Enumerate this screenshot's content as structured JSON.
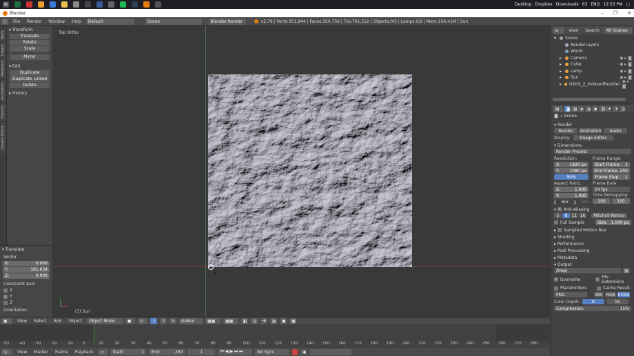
{
  "taskbar": {
    "items": [
      "Desktop",
      "Dropbox",
      "Downloads"
    ],
    "battery": "63",
    "lang": "ENG",
    "time": "12:53 PM"
  },
  "window": {
    "title": "Blender"
  },
  "info": {
    "menus": [
      "File",
      "Render",
      "Window",
      "Help"
    ],
    "layout": "Default",
    "scene": "Scene",
    "engine": "Blender Render",
    "stats": "v2.79 | Verts:351,944 | Faces:350,756 | Tris:701,512 | Objects:0/5 | Lamps:0/2 | Mem:106.41M | Sun"
  },
  "toolshelf": {
    "tabs": [
      "Tools",
      "Create",
      "Relations",
      "Animation",
      "Physics",
      "Grease Pencil"
    ],
    "transform": {
      "title": "Transform",
      "buttons": [
        "Translate",
        "Rotate",
        "Scale",
        "Mirror"
      ]
    },
    "edit": {
      "title": "Edit",
      "buttons": [
        "Duplicate",
        "Duplicate Linked",
        "Delete"
      ]
    },
    "history": "History"
  },
  "redo": {
    "title": "Translate",
    "vector_label": "Vector",
    "x_label": "X:",
    "x": "0.000",
    "y_label": "Y:",
    "y": "161.634",
    "z_label": "Z:",
    "z": "0.000",
    "constraint_label": "Constraint Axis",
    "axes": [
      {
        "label": "X",
        "checked": false
      },
      {
        "label": "Y",
        "checked": true
      },
      {
        "label": "Z",
        "checked": false
      }
    ],
    "orientation": "Orientation"
  },
  "viewport": {
    "view_name": "Top Ortho",
    "object_name": "(1) Sun"
  },
  "vp_header": {
    "menus": [
      "View",
      "Select",
      "Add",
      "Object"
    ],
    "mode": "Object Mode",
    "orientation": "Global"
  },
  "timeline": {
    "ticks": [
      "-50",
      "-40",
      "-30",
      "-20",
      "-10",
      "0",
      "10",
      "20",
      "30",
      "40",
      "50",
      "60",
      "70",
      "80",
      "90",
      "100",
      "110",
      "120",
      "130",
      "140",
      "150",
      "160",
      "170",
      "180",
      "190",
      "200",
      "210",
      "220",
      "230",
      "240",
      "250",
      "260",
      "270",
      "280"
    ],
    "menus": [
      "View",
      "Marker",
      "Frame",
      "Playback"
    ],
    "start": "Start:",
    "start_val": "1",
    "end": "End:",
    "end_val": "250",
    "current": "1",
    "sync": "No Sync"
  },
  "outliner": {
    "menus": [
      "View",
      "Search"
    ],
    "filter": "All Scenes",
    "items": [
      {
        "label": "Scene",
        "color": "#9aa"
      },
      {
        "label": "RenderLayers",
        "color": "#aac"
      },
      {
        "label": "World",
        "color": "#7ab"
      },
      {
        "label": "Camera",
        "color": "#e8a040"
      },
      {
        "label": "Cube",
        "color": "#e8a040"
      },
      {
        "label": "Lamp",
        "color": "#e8a040"
      },
      {
        "label": "Sun",
        "color": "#e8a040"
      },
      {
        "label": "USGS_2_IndexedFaceSet",
        "color": "#e8a040"
      }
    ]
  },
  "props": {
    "scene": "Scene",
    "render_sec": "Render",
    "render_btns": [
      "Render",
      "Animation",
      "Audio"
    ],
    "display_label": "Display:",
    "display_value": "Image Editor",
    "dimensions_sec": "Dimensions",
    "presets": "Render Presets",
    "resolution_label": "Resolution:",
    "res_x": "X:",
    "res_x_val": "1920 px",
    "res_y": "Y:",
    "res_y_val": "1080 px",
    "res_pct": "50%",
    "frame_range_label": "Frame Range:",
    "start_frame": "Start Frame:",
    "start_frame_val": "1",
    "end_frame": "End Frame:",
    "end_frame_val": "250",
    "frame_step": "Frame Step:",
    "frame_step_val": "1",
    "aspect_label": "Aspect Ratio:",
    "asp_x": "X:",
    "asp_x_val": "1.000",
    "asp_y": "Y:",
    "asp_y_val": "1.000",
    "frame_rate_label": "Frame Rate:",
    "fps": "24 fps",
    "time_remap": "Time Remapping:",
    "remap_a": "100",
    "remap_b": "100",
    "bor": "Bor",
    "cro": "Cro",
    "aa_sec": "Anti-Aliasing",
    "aa_samples": [
      "5",
      "8",
      "11",
      "16"
    ],
    "aa_filter": "Mitchell-Netrav",
    "full_sample": "Full Sample",
    "aa_size": "Size:",
    "aa_size_val": "1.000 px",
    "motion_blur": "Sampled Motion Blur",
    "shading": "Shading",
    "performance": "Performance",
    "post": "Post Processing",
    "metadata": "Metadata",
    "output_sec": "Output",
    "output_path": "/tmp\\",
    "overwrite": "Overwrite",
    "file_ext": "File Extensions",
    "placeholders": "Placeholders",
    "cache": "Cache Result",
    "format": "PNG",
    "bw": "BW",
    "rgb": "RGB",
    "rgba": "RGBA",
    "color_depth": "Color Depth:",
    "depth_a": "8",
    "depth_b": "16",
    "compression": "Compression:",
    "compression_val": "15%"
  }
}
